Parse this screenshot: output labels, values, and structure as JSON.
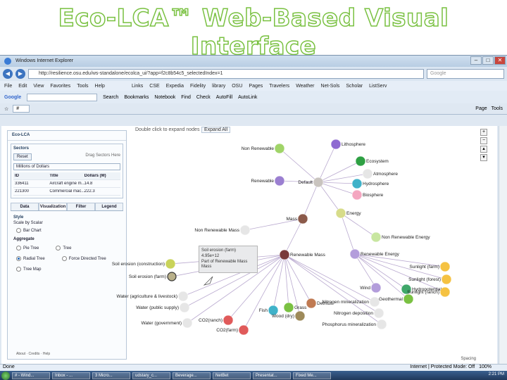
{
  "slide_title": "Eco-LCA™ Web-Based Visual Interface",
  "browser": {
    "window_title": "Windows Internet Explorer",
    "url": "http://resilience.osu.edu/ws-standalone/ecolca_ui/?app=f2c8b54c5_selectedIndex=1",
    "search_placeholder": "Google",
    "menu": [
      "File",
      "Edit",
      "View",
      "Favorites",
      "Tools",
      "Help"
    ],
    "links": [
      "Links",
      "CSE",
      "Expedia",
      "Fidelity",
      "library",
      "OSU",
      "Pages",
      "Travelers",
      "Weather",
      "Net-Sols",
      "Scholar",
      "ListServ"
    ],
    "google_bar": [
      "Google",
      "Search",
      "Bookmarks",
      "Notebook",
      "Find",
      "Check",
      "AutoFill",
      "AutoLink"
    ],
    "tab_label": "#",
    "right_tools": [
      "Page",
      "Tools"
    ],
    "status_left": "Done",
    "status_right": "Internet | Protected Mode: Off",
    "zoom": "100%"
  },
  "app": {
    "name": "Eco-LCA",
    "sectors_title": "Sectors",
    "reset_label": "Reset",
    "search_label": "Drag Sectors Here",
    "units_label": "Millions of Dollars",
    "columns": [
      "ID",
      "Title",
      "Dollars (M)"
    ],
    "rows": [
      [
        "336411",
        "Aircraft engine m...",
        "14.8"
      ],
      [
        "221300",
        "Commercial mac...",
        "222.3"
      ]
    ],
    "tabs": [
      "Data",
      "Visualization",
      "Filter",
      "Legend"
    ],
    "style_title": "Style",
    "scale_label": "Scale by Scalar",
    "scale_options": [
      "Bar Chart"
    ],
    "aggregate_label": "Aggregate",
    "layout_options": [
      "Pie Tree",
      "Tree",
      "Radial Tree",
      "Force Directed Tree",
      "Tree Map"
    ],
    "footer": [
      "About",
      "Credits",
      "Help"
    ],
    "canvas_hint": "Double click to expand nodes",
    "expand_all": "Expand All",
    "spacing_label": "Spacing",
    "tooltip": [
      "Soil erosion (farm)",
      "4.95e+12",
      "Part of Renewable Mass",
      "Mass"
    ]
  },
  "graph": {
    "nodes": [
      {
        "id": "default",
        "label": "Default",
        "color": "#c9c4bf"
      },
      {
        "id": "nonrenew",
        "label": "Non Renewable",
        "color": "#a0d468"
      },
      {
        "id": "lithosphere",
        "label": "Lithosphere",
        "color": "#8e6ad1"
      },
      {
        "id": "ecosystem",
        "label": "Ecosystem",
        "color": "#2ea043"
      },
      {
        "id": "atmosphere",
        "label": "Atmosphere",
        "color": "#e6e6e6"
      },
      {
        "id": "hydrosphere",
        "label": "Hydrosphere",
        "color": "#3fb2c9"
      },
      {
        "id": "biosphere",
        "label": "Biosphere",
        "color": "#f4a6c0"
      },
      {
        "id": "renewable",
        "label": "Renewable",
        "color": "#9b7fd1"
      },
      {
        "id": "energy",
        "label": "Energy",
        "color": "#d7dc8a"
      },
      {
        "id": "mass",
        "label": "Mass",
        "color": "#8b5a4a"
      },
      {
        "id": "nonrenewmass",
        "label": "Non Renewable Mass",
        "color": "#e6e6e6"
      },
      {
        "id": "nonrenewenergy",
        "label": "Non Renewable Energy",
        "color": "#c8e6a0"
      },
      {
        "id": "renewmass",
        "label": "Renewable Mass",
        "color": "#7a3a3a"
      },
      {
        "id": "renewenergy",
        "label": "Renewable Energy",
        "color": "#b39ddb"
      },
      {
        "id": "soilconst",
        "label": "Soil erosion (construction)",
        "color": "#c9d35a"
      },
      {
        "id": "soilfarm",
        "label": "Soil erosion (farm)",
        "color": "#b9b08a"
      },
      {
        "id": "waterag",
        "label": "Water (agriculture & livestock)",
        "color": "#e6e6e6"
      },
      {
        "id": "waterpub",
        "label": "Water (public supply)",
        "color": "#e6e6e6"
      },
      {
        "id": "watergov",
        "label": "Water (government)",
        "color": "#e6e6e6"
      },
      {
        "id": "co2farm",
        "label": "CO2(farm)",
        "color": "#e05a5a"
      },
      {
        "id": "co2ranch",
        "label": "CO2(ranch)",
        "color": "#e05a5a"
      },
      {
        "id": "fish",
        "label": "Fish",
        "color": "#3fb2c9"
      },
      {
        "id": "grass",
        "label": "Grass",
        "color": "#7ac142"
      },
      {
        "id": "detritus",
        "label": "Detritus",
        "color": "#c07a52"
      },
      {
        "id": "wood",
        "label": "Wood (dry)",
        "color": "#9e8a5a"
      },
      {
        "id": "nitromin",
        "label": "Nitrogen mineralization",
        "color": "#e6e6e6"
      },
      {
        "id": "nitrodep",
        "label": "Nitrogen deposition",
        "color": "#e6e6e6"
      },
      {
        "id": "phosmin",
        "label": "Phosphorus mineralization",
        "color": "#e6e6e6"
      },
      {
        "id": "wind",
        "label": "Wind",
        "color": "#b39ddb"
      },
      {
        "id": "hydro",
        "label": "Hydropotential",
        "color": "#3fa76a"
      },
      {
        "id": "geo",
        "label": "Geothermal",
        "color": "#7ac142"
      },
      {
        "id": "sunfarm",
        "label": "Sunlight (farm)",
        "color": "#f5c242"
      },
      {
        "id": "sunforest",
        "label": "Sunlight (forest)",
        "color": "#f5c242"
      },
      {
        "id": "sunranch",
        "label": "Sunlight (ranch)",
        "color": "#f5c242"
      }
    ],
    "edges": [
      [
        "default",
        "nonrenew"
      ],
      [
        "default",
        "lithosphere"
      ],
      [
        "default",
        "ecosystem"
      ],
      [
        "default",
        "atmosphere"
      ],
      [
        "default",
        "hydrosphere"
      ],
      [
        "default",
        "biosphere"
      ],
      [
        "default",
        "renewable"
      ],
      [
        "default",
        "energy"
      ],
      [
        "default",
        "mass"
      ],
      [
        "mass",
        "nonrenewmass"
      ],
      [
        "mass",
        "renewmass"
      ],
      [
        "energy",
        "nonrenewenergy"
      ],
      [
        "energy",
        "renewenergy"
      ],
      [
        "renewmass",
        "soilconst"
      ],
      [
        "renewmass",
        "soilfarm"
      ],
      [
        "renewmass",
        "waterag"
      ],
      [
        "renewmass",
        "waterpub"
      ],
      [
        "renewmass",
        "watergov"
      ],
      [
        "renewmass",
        "co2farm"
      ],
      [
        "renewmass",
        "co2ranch"
      ],
      [
        "renewmass",
        "fish"
      ],
      [
        "renewmass",
        "grass"
      ],
      [
        "renewmass",
        "detritus"
      ],
      [
        "renewmass",
        "wood"
      ],
      [
        "renewmass",
        "nitromin"
      ],
      [
        "renewmass",
        "nitrodep"
      ],
      [
        "renewmass",
        "phosmin"
      ],
      [
        "renewenergy",
        "wind"
      ],
      [
        "renewenergy",
        "hydro"
      ],
      [
        "renewenergy",
        "geo"
      ],
      [
        "renewenergy",
        "sunfarm"
      ],
      [
        "renewenergy",
        "sunforest"
      ],
      [
        "renewenergy",
        "sunranch"
      ]
    ]
  },
  "taskbar": {
    "items": [
      "# - Wind...",
      "Inbox - ...",
      "3 Micro...",
      "udstary_c...",
      "Beverage...",
      "NetBet",
      "Presentat...",
      "Fixed Me..."
    ],
    "clock": "2:21 PM"
  }
}
